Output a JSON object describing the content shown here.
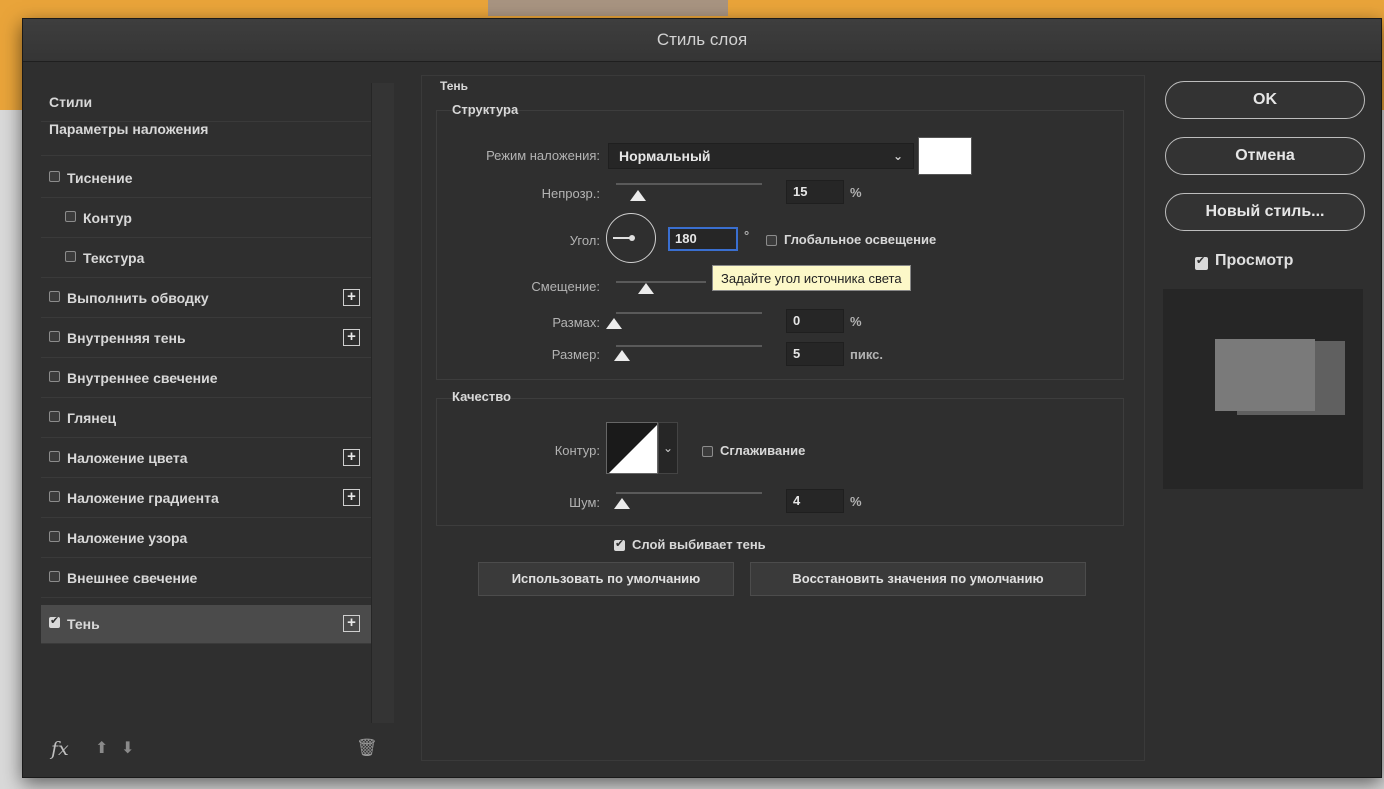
{
  "dialog": {
    "title": "Стиль слоя"
  },
  "left_panel": {
    "header": "Стили",
    "blend_options": "Параметры наложения",
    "items": [
      {
        "label": "Тиснение",
        "checked": false,
        "plus": false,
        "indent": false
      },
      {
        "label": "Контур",
        "checked": false,
        "plus": false,
        "indent": true
      },
      {
        "label": "Текстура",
        "checked": false,
        "plus": false,
        "indent": true
      },
      {
        "label": "Выполнить обводку",
        "checked": false,
        "plus": true,
        "indent": false
      },
      {
        "label": "Внутренняя тень",
        "checked": false,
        "plus": true,
        "indent": false
      },
      {
        "label": "Внутреннее свечение",
        "checked": false,
        "plus": false,
        "indent": false
      },
      {
        "label": "Глянец",
        "checked": false,
        "plus": false,
        "indent": false
      },
      {
        "label": "Наложение цвета",
        "checked": false,
        "plus": true,
        "indent": false
      },
      {
        "label": "Наложение градиента",
        "checked": false,
        "plus": true,
        "indent": false
      },
      {
        "label": "Наложение узора",
        "checked": false,
        "plus": false,
        "indent": false
      },
      {
        "label": "Внешнее свечение",
        "checked": false,
        "plus": false,
        "indent": false
      },
      {
        "label": "Тень",
        "checked": true,
        "plus": true,
        "indent": false,
        "selected": true
      }
    ],
    "fx_label": "fx",
    "plus_glyph": "+"
  },
  "shadow": {
    "section_title": "Тень",
    "structure": {
      "title": "Структура",
      "blend_mode_label": "Режим наложения:",
      "blend_mode_value": "Нормальный",
      "opacity_label": "Непрозр.:",
      "opacity_value": "15",
      "opacity_unit": "%",
      "angle_label": "Угол:",
      "angle_value": "180",
      "angle_unit": "°",
      "global_light_label": "Глобальное освещение",
      "tooltip": "Задайте угол источника света",
      "distance_label": "Смещение:",
      "spread_label": "Размах:",
      "spread_value": "0",
      "spread_unit": "%",
      "size_label": "Размер:",
      "size_value": "5",
      "size_unit": "пикс."
    },
    "quality": {
      "title": "Качество",
      "contour_label": "Контур:",
      "antialias_label": "Сглаживание",
      "noise_label": "Шум:",
      "noise_value": "4",
      "noise_unit": "%"
    },
    "knockout_label": "Слой выбивает тень",
    "make_default_label": "Использовать по умолчанию",
    "reset_default_label": "Восстановить значения по умолчанию"
  },
  "right_panel": {
    "ok_label": "OK",
    "cancel_label": "Отмена",
    "new_style_label": "Новый стиль...",
    "preview_label": "Просмотр",
    "preview_checked": true
  },
  "colors": {
    "shadow_color": "#ffffff",
    "focus_blue": "#3a6fd0",
    "accent_backdrop": "#e9a43a"
  },
  "sliders": {
    "opacity_fraction": 0.15,
    "distance_fraction": 0.2,
    "spread_fraction": 0.0,
    "size_fraction": 0.05,
    "noise_fraction": 0.04
  }
}
